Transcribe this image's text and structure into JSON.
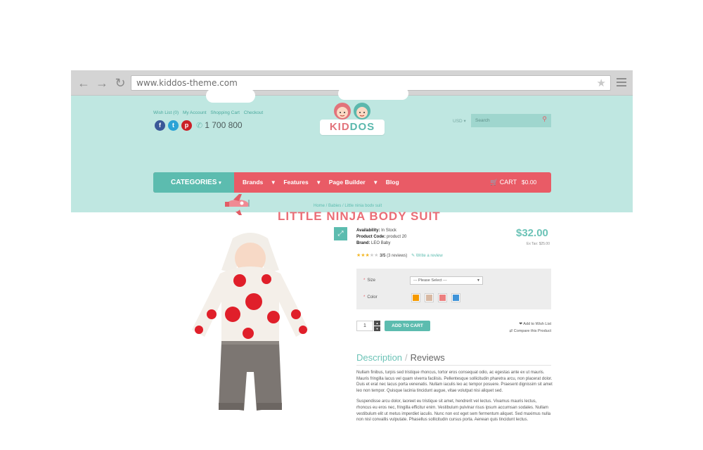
{
  "browser": {
    "url": "www.kiddos-theme.com",
    "back_icon": "back-arrow-icon",
    "forward_icon": "forward-arrow-icon",
    "reload_icon": "reload-icon"
  },
  "header": {
    "top_links": [
      "Wish List (0)",
      "My Account",
      "Shopping Cart",
      "Checkout"
    ],
    "social": [
      "f",
      "t",
      "p"
    ],
    "phone": "1 700 800",
    "logo_text": "KIDDOS",
    "currency": "USD",
    "search_placeholder": "Search"
  },
  "nav": {
    "categories": "CATEGORIES",
    "links": [
      "Brands",
      "Features",
      "Page Builder",
      "Blog"
    ],
    "cart_label": "CART",
    "cart_total": "$0.00"
  },
  "breadcrumb": [
    "Home",
    "Babies",
    "Little ninja body suit"
  ],
  "page_title": "LITTLE NINJA BODY SUIT",
  "product": {
    "availability_label": "Availability:",
    "availability": "In Stock",
    "code_label": "Product Code:",
    "code": "product 20",
    "brand_label": "Brand:",
    "brand": "LEO Baby",
    "price": "$32.00",
    "ex_tax": "Ex Tax: $25.00",
    "rating_value": 3,
    "rating_text": "3/5",
    "reviews_count": "(3 reviews)",
    "write_review": "Write a review",
    "size_label": "Size",
    "size_select": "--- Please Select ---",
    "color_label": "Color",
    "colors": [
      "#f59a00",
      "#d8b9a3",
      "#ec7f7f",
      "#3f93d8"
    ],
    "quantity": "1",
    "add_to_cart": "ADD TO CART",
    "wishlist": "Add to Wish List",
    "compare": "Compare this Product"
  },
  "tabs": {
    "description": "Description",
    "reviews": "Reviews"
  },
  "description": [
    "Nullam finibus, turpis sed tristique rhoncus, tortor eros consequat odio, ac egestas ante ex ut mauris. Mauris fringilla lacus vel quam viverra facilisis. Pellentesque sollicitudin pharetra arcu, non placerat dolor. Duis et erat nec lacus porta venenatis. Nullam iaculis leo ac tempor posuere. Praesent dignissim sit amet leo non tempor. Quisque lacinia tincidunt augue, vitae volutpat nisi aliquet sed.",
    "Suspendisse arcu dolor, laoreet eu tristique sit amet, hendrerit vel lectus. Vivamus mauris lectus, rhoncus eu eros nec, fringilla efficitur enim. Vestibulum pulvinar risus ipsum accumsan sodales. Nullam vestibulum elit ut metus imperdiet iaculis. Nunc non est eget sem fermentum aliquet. Sed maximus nulla non nisl convallis vulputate. Phasellus sollicitudin cursus porta. Aenean quis tincidunt lectus."
  ]
}
